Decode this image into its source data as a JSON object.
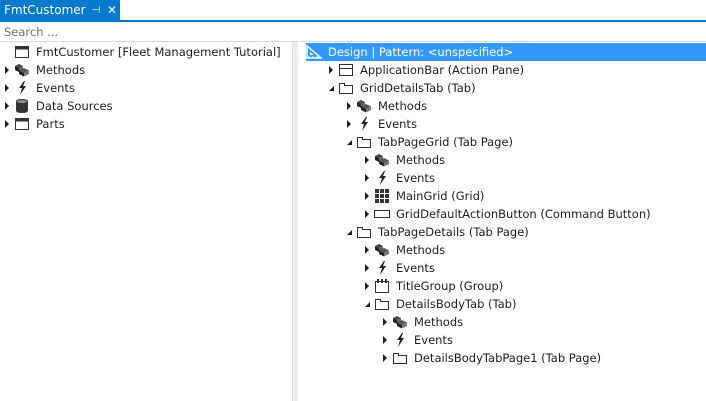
{
  "tab": {
    "title": "FmtCustomer",
    "pin_glyph": "⊣",
    "close_glyph": "✕"
  },
  "search": {
    "placeholder": "Search ..."
  },
  "left_tree": [
    {
      "label": "FmtCustomer [Fleet Management Tutorial]",
      "icon": "form-icon",
      "level": 0,
      "state": "none"
    },
    {
      "label": "Methods",
      "icon": "methods-icon",
      "level": 1,
      "state": "collapsed"
    },
    {
      "label": "Events",
      "icon": "events-icon",
      "level": 1,
      "state": "collapsed"
    },
    {
      "label": "Data Sources",
      "icon": "datasource-icon",
      "level": 1,
      "state": "collapsed"
    },
    {
      "label": "Parts",
      "icon": "parts-icon",
      "level": 1,
      "state": "collapsed"
    }
  ],
  "right_tree": [
    {
      "label": "Design | Pattern: <unspecified>",
      "icon": "design-icon",
      "level": 0,
      "state": "none",
      "selected": true
    },
    {
      "label": "ApplicationBar (Action Pane)",
      "icon": "actionpane-icon",
      "level": 1,
      "state": "collapsed"
    },
    {
      "label": "GridDetailsTab (Tab)",
      "icon": "tab-icon",
      "level": 1,
      "state": "expanded"
    },
    {
      "label": "Methods",
      "icon": "methods-icon",
      "level": 2,
      "state": "collapsed"
    },
    {
      "label": "Events",
      "icon": "events-icon",
      "level": 2,
      "state": "collapsed"
    },
    {
      "label": "TabPageGrid (Tab Page)",
      "icon": "tab-icon",
      "level": 2,
      "state": "expanded"
    },
    {
      "label": "Methods",
      "icon": "methods-icon",
      "level": 3,
      "state": "collapsed"
    },
    {
      "label": "Events",
      "icon": "events-icon",
      "level": 3,
      "state": "collapsed"
    },
    {
      "label": "MainGrid (Grid)",
      "icon": "grid-icon",
      "level": 3,
      "state": "collapsed"
    },
    {
      "label": "GridDefaultActionButton (Command Button)",
      "icon": "button-icon",
      "level": 3,
      "state": "collapsed"
    },
    {
      "label": "TabPageDetails (Tab Page)",
      "icon": "tab-icon",
      "level": 2,
      "state": "expanded"
    },
    {
      "label": "Methods",
      "icon": "methods-icon",
      "level": 3,
      "state": "collapsed"
    },
    {
      "label": "Events",
      "icon": "events-icon",
      "level": 3,
      "state": "collapsed"
    },
    {
      "label": "TitleGroup (Group)",
      "icon": "group-icon",
      "level": 3,
      "state": "collapsed"
    },
    {
      "label": "DetailsBodyTab (Tab)",
      "icon": "tab-icon",
      "level": 3,
      "state": "expanded"
    },
    {
      "label": "Methods",
      "icon": "methods-icon",
      "level": 4,
      "state": "collapsed"
    },
    {
      "label": "Events",
      "icon": "events-icon",
      "level": 4,
      "state": "collapsed"
    },
    {
      "label": "DetailsBodyTabPage1 (Tab Page)",
      "icon": "tab-icon",
      "level": 4,
      "state": "collapsed"
    }
  ],
  "colors": {
    "accent": "#007acc",
    "selection": "#3399ff"
  }
}
